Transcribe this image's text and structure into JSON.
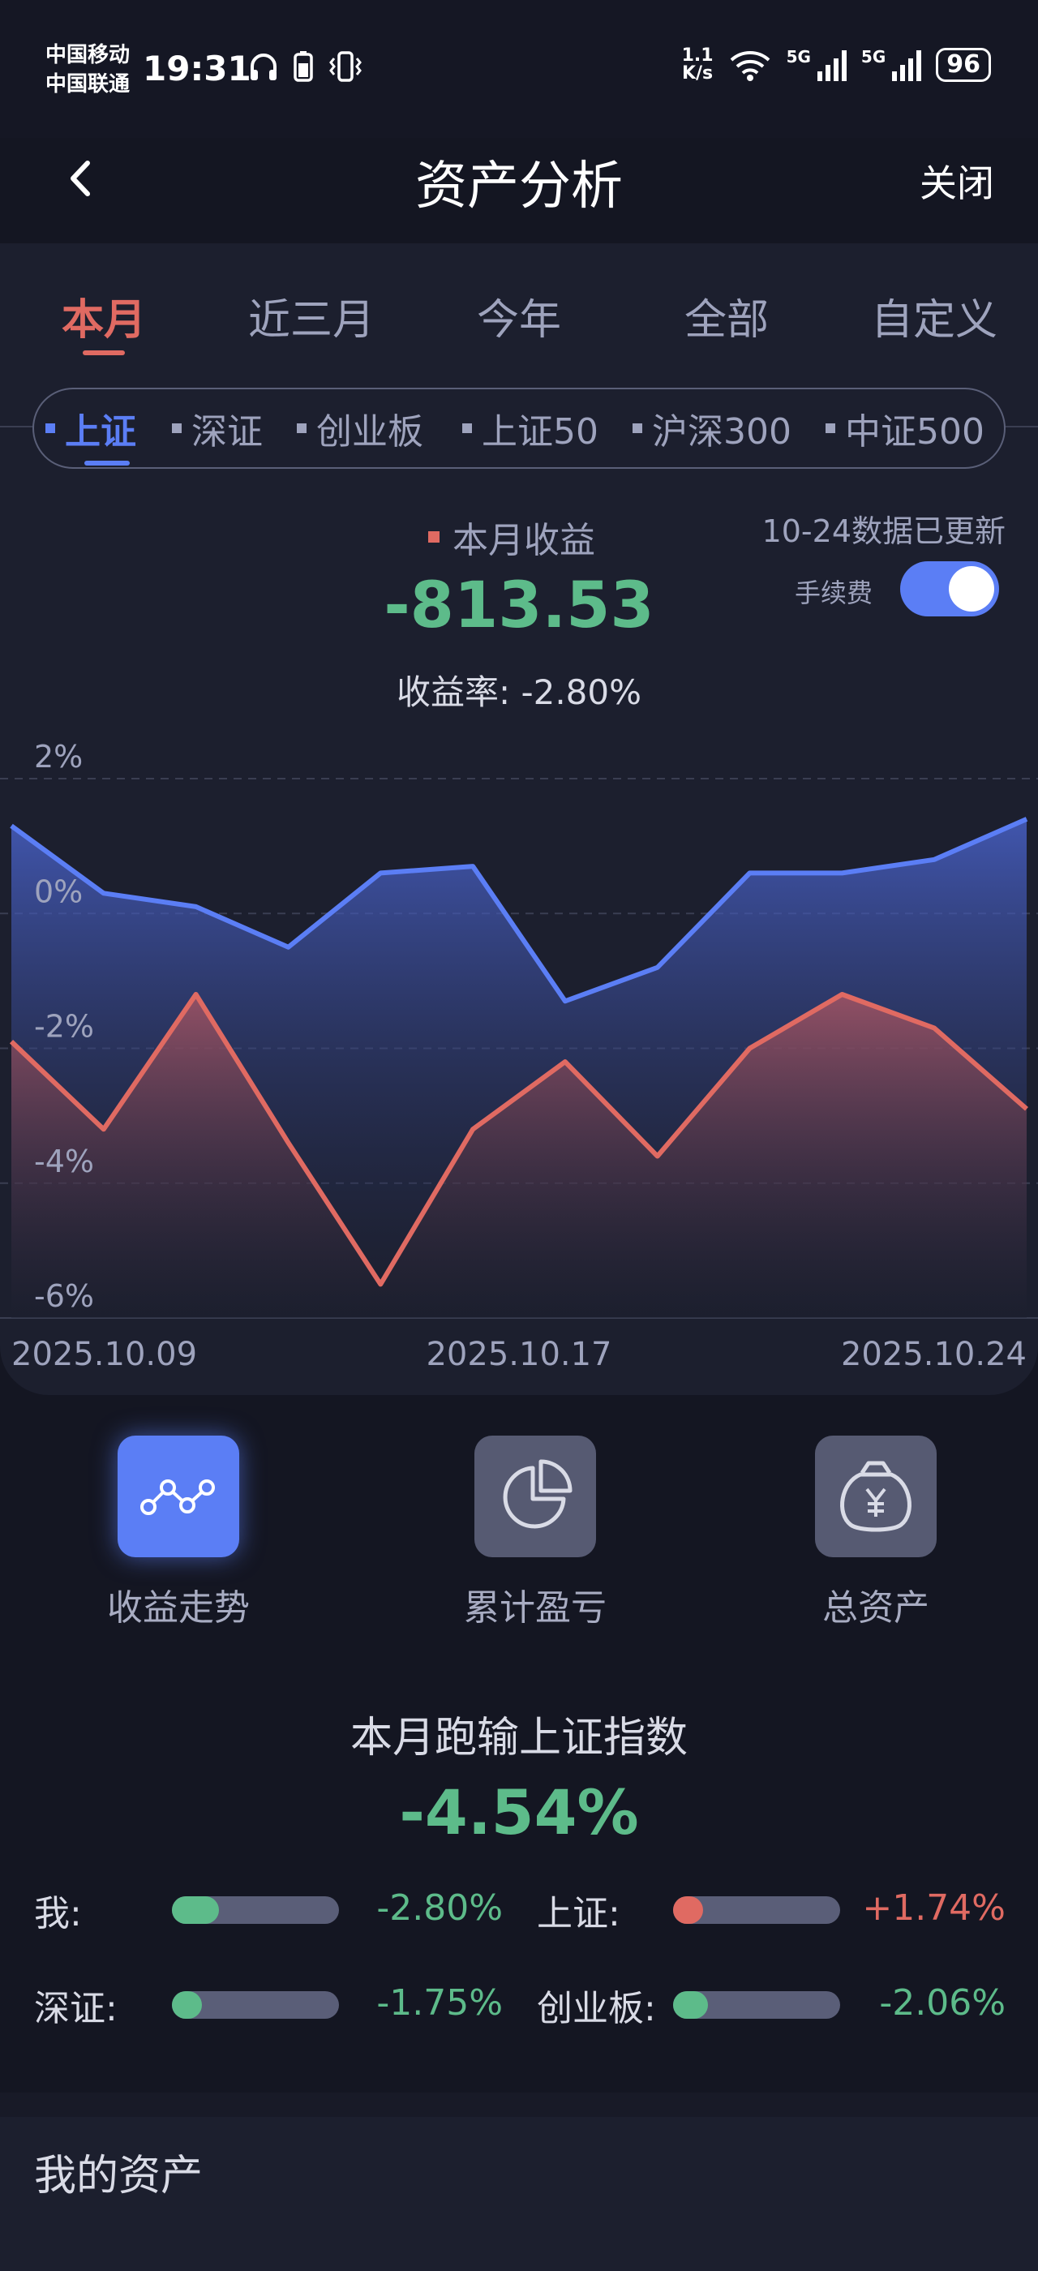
{
  "status_bar": {
    "carrier_1": "中国移动",
    "carrier_2": "中国联通",
    "time": "19:31",
    "net_speed_value": "1.1",
    "net_speed_unit": "K/s",
    "net_label_1": "5G",
    "net_label_2": "5G",
    "battery": "96"
  },
  "nav": {
    "back_icon": "chevron-left-icon",
    "title": "资产分析",
    "close_label": "关闭"
  },
  "period_tabs": [
    {
      "label": "本月",
      "active": true
    },
    {
      "label": "近三月",
      "active": false
    },
    {
      "label": "今年",
      "active": false
    },
    {
      "label": "全部",
      "active": false
    },
    {
      "label": "自定义",
      "active": false
    }
  ],
  "index_tabs": [
    {
      "label": "上证",
      "active": true
    },
    {
      "label": "深证",
      "active": false
    },
    {
      "label": "创业板",
      "active": false
    },
    {
      "label": "上证50",
      "active": false
    },
    {
      "label": "沪深300",
      "active": false
    },
    {
      "label": "中证500",
      "active": false
    }
  ],
  "summary": {
    "label": "本月收益",
    "value": "-813.53",
    "rate": "收益率: -2.80%",
    "updated": "10-24数据已更新",
    "fee_label": "手续费",
    "fee_toggle_on": true
  },
  "chart_data": {
    "type": "area",
    "x": [
      "2025.10.09",
      "",
      "",
      "",
      "",
      "",
      "2025.10.17",
      "",
      "",
      "",
      "",
      "2025.10.24"
    ],
    "x_tick_labels": [
      "2025.10.09",
      "2025.10.17",
      "2025.10.24"
    ],
    "y_tick_labels": [
      "2%",
      "0%",
      "-2%",
      "-4%",
      "-6%"
    ],
    "ylim": [
      -6,
      2
    ],
    "series": [
      {
        "color": "#5b7ef5",
        "values": [
          1.3,
          0.3,
          0.1,
          -0.5,
          0.6,
          0.7,
          -1.3,
          -0.8,
          0.6,
          0.6,
          0.8,
          1.4
        ]
      },
      {
        "color": "#e06a62",
        "values": [
          -1.9,
          -3.2,
          -1.2,
          -3.4,
          -5.5,
          -3.2,
          -2.2,
          -3.6,
          -2.0,
          -1.2,
          -1.7,
          -2.9
        ]
      }
    ],
    "grid": true
  },
  "tools": [
    {
      "label": "收益走势",
      "icon": "trend-chart-icon",
      "active": true
    },
    {
      "label": "累计盈亏",
      "icon": "pie-chart-icon",
      "active": false
    },
    {
      "label": "总资产",
      "icon": "money-bag-icon",
      "active": false
    }
  ],
  "compare": {
    "title": "本月跑输上证指数",
    "value": "-4.54%",
    "rows": [
      {
        "name": "我:",
        "value": "-2.80%",
        "fill": 0.28,
        "color": "#5dbb8a"
      },
      {
        "name": "上证:",
        "value": "+1.74%",
        "fill": 0.18,
        "color": "#e06a62"
      },
      {
        "name": "深证:",
        "value": "-1.75%",
        "fill": 0.18,
        "color": "#5dbb8a"
      },
      {
        "name": "创业板:",
        "value": "-2.06%",
        "fill": 0.21,
        "color": "#5dbb8a"
      }
    ]
  },
  "assets": {
    "title": "我的资产"
  }
}
